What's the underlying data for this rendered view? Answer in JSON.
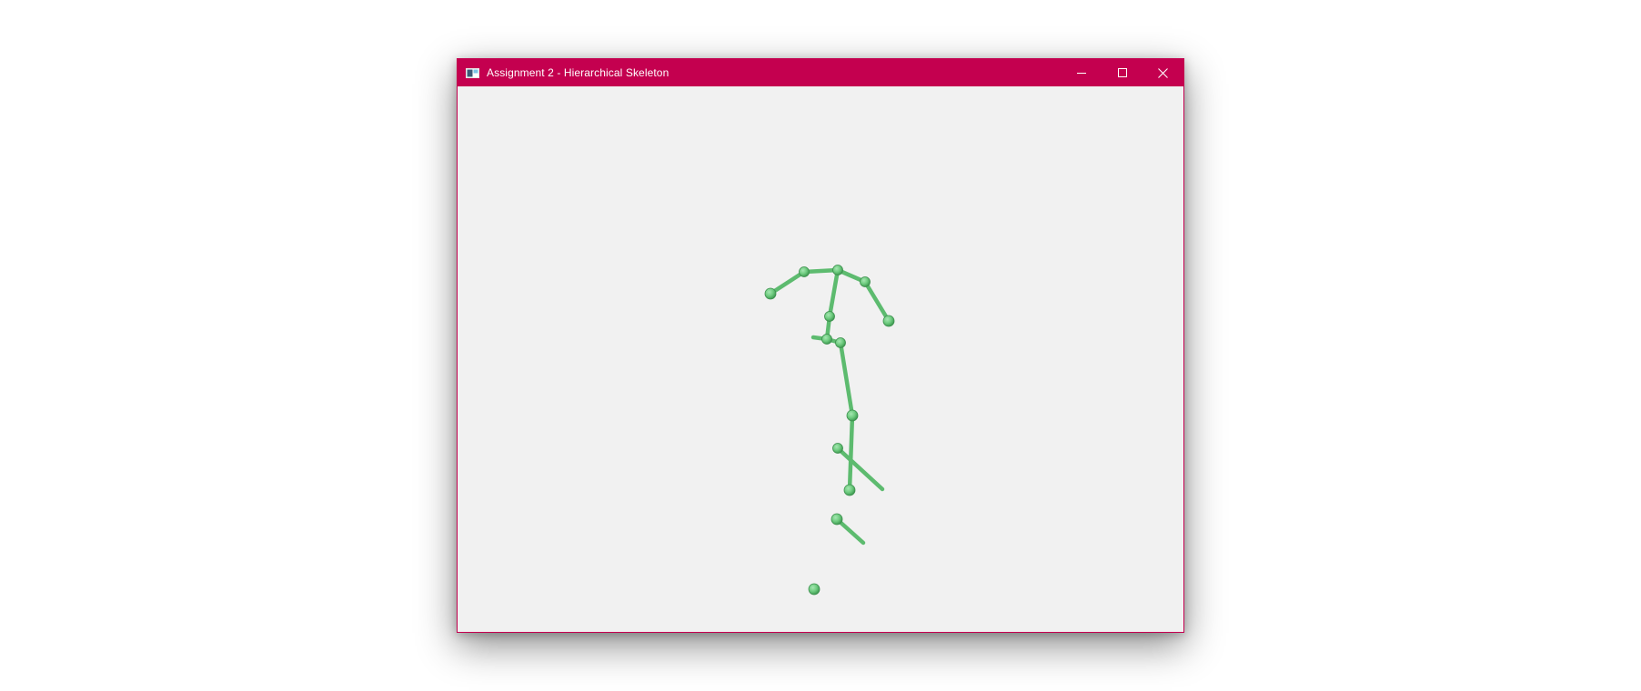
{
  "window": {
    "title": "Assignment 2 - Hierarchical Skeleton",
    "titlebar_color": "#c4004f",
    "client_background": "#f1f1f1",
    "icons": {
      "app": "app-window-icon",
      "minimize": "minimize-icon",
      "maximize": "maximize-icon",
      "close": "close-icon"
    }
  },
  "skeleton": {
    "bone_color": "#6ec77e",
    "joint_color": "#6fcc80"
  }
}
